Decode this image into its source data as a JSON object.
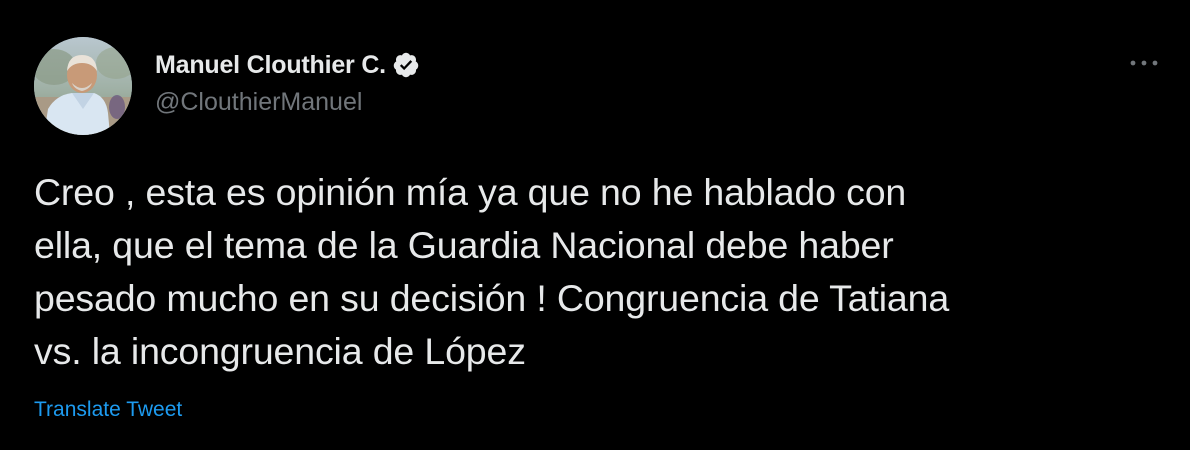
{
  "author": {
    "display_name": "Manuel Clouthier C.",
    "handle": "@ClouthierManuel",
    "verified_icon": "verified-badge-icon"
  },
  "more_icon": "ellipsis-icon",
  "tweet": {
    "text_lines": [
      "Creo , esta es opinión mía ya que no he hablado con",
      "ella, que el tema de la Guardia Nacional debe haber",
      "pesado mucho en su decisión ! Congruencia de Tatiana",
      "vs. la incongruencia de López"
    ]
  },
  "translate_label": "Translate Tweet",
  "colors": {
    "background": "#000000",
    "text": "#e7e9ea",
    "secondary": "#71767b",
    "link": "#1d9bf0"
  }
}
